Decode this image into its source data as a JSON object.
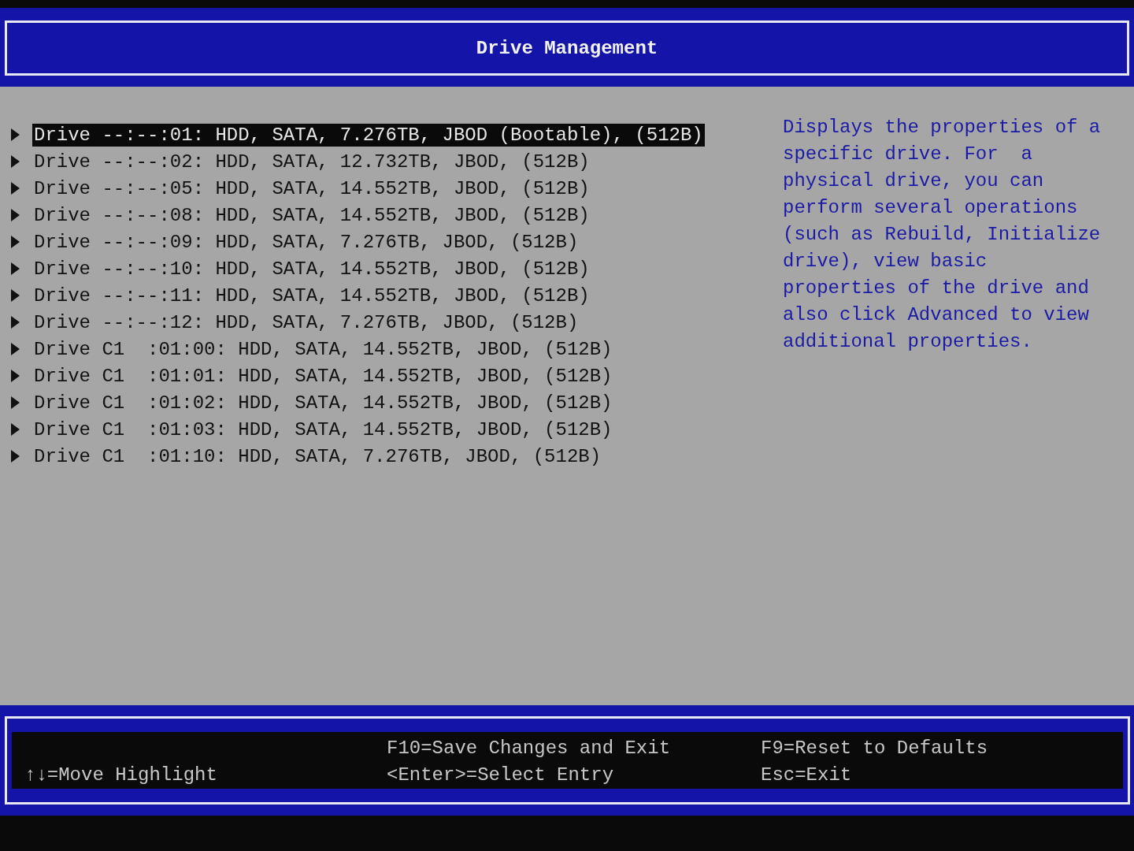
{
  "header": {
    "title": "Drive Management"
  },
  "drives": [
    {
      "label": "Drive --:--:01: HDD, SATA, 7.276TB, JBOD (Bootable), (512B)",
      "selected": true
    },
    {
      "label": "Drive --:--:02: HDD, SATA, 12.732TB, JBOD, (512B)",
      "selected": false
    },
    {
      "label": "Drive --:--:05: HDD, SATA, 14.552TB, JBOD, (512B)",
      "selected": false
    },
    {
      "label": "Drive --:--:08: HDD, SATA, 14.552TB, JBOD, (512B)",
      "selected": false
    },
    {
      "label": "Drive --:--:09: HDD, SATA, 7.276TB, JBOD, (512B)",
      "selected": false
    },
    {
      "label": "Drive --:--:10: HDD, SATA, 14.552TB, JBOD, (512B)",
      "selected": false
    },
    {
      "label": "Drive --:--:11: HDD, SATA, 14.552TB, JBOD, (512B)",
      "selected": false
    },
    {
      "label": "Drive --:--:12: HDD, SATA, 7.276TB, JBOD, (512B)",
      "selected": false
    },
    {
      "label": "Drive C1  :01:00: HDD, SATA, 14.552TB, JBOD, (512B)",
      "selected": false
    },
    {
      "label": "Drive C1  :01:01: HDD, SATA, 14.552TB, JBOD, (512B)",
      "selected": false
    },
    {
      "label": "Drive C1  :01:02: HDD, SATA, 14.552TB, JBOD, (512B)",
      "selected": false
    },
    {
      "label": "Drive C1  :01:03: HDD, SATA, 14.552TB, JBOD, (512B)",
      "selected": false
    },
    {
      "label": "Drive C1  :01:10: HDD, SATA, 7.276TB, JBOD, (512B)",
      "selected": false
    }
  ],
  "help_text": "Displays the properties of a\nspecific drive. For  a\nphysical drive, you can\nperform several operations\n(such as Rebuild, Initialize\ndrive), view basic\nproperties of the drive and\nalso click Advanced to view\nadditional properties.",
  "footer": {
    "column_1": [
      "↑↓=Move Highlight"
    ],
    "column_2": [
      "F10=Save Changes and Exit",
      "<Enter>=Select Entry"
    ],
    "column_3": [
      "F9=Reset to Defaults",
      "Esc=Exit"
    ]
  }
}
